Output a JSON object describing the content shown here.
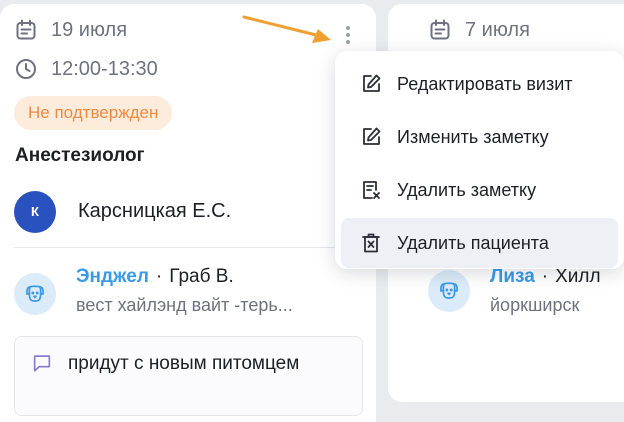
{
  "left_card": {
    "date": "19 июля",
    "time": "12:00-13:30",
    "status": "Не подтвержден",
    "role": "Анестезиолог",
    "doctor_initial": "К",
    "doctor_name": "Карсницкая Е.С.",
    "pet": {
      "name": "Энджел",
      "separator": "·",
      "owner": "Граб В.",
      "breed": "вест хайлэнд вайт -терь..."
    },
    "note": "придут с новым питомцем"
  },
  "right_card": {
    "date": "7 июля",
    "pet": {
      "name": "Лиза",
      "separator": "·",
      "owner": "Хилл",
      "breed": "йоркширск"
    }
  },
  "context_menu": {
    "items": [
      {
        "label": "Редактировать визит",
        "icon": "edit-icon"
      },
      {
        "label": "Изменить заметку",
        "icon": "edit-note-icon"
      },
      {
        "label": "Удалить заметку",
        "icon": "delete-note-icon"
      },
      {
        "label": "Удалить пациента",
        "icon": "delete-patient-icon"
      }
    ]
  },
  "colors": {
    "accent_blue": "#3a9ae6",
    "status_orange": "#f08a3e",
    "status_bg": "#fdebdc",
    "avatar_blue": "#2a52be",
    "annotation_arrow": "#f0a030"
  }
}
